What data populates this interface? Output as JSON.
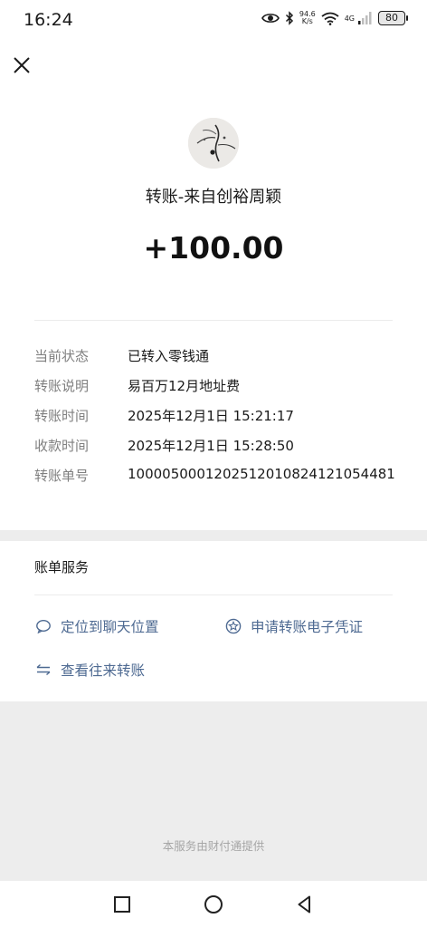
{
  "status_bar": {
    "time": "16:24",
    "net_speed_value": "94.6",
    "net_speed_unit": "K/s",
    "net_type": "4G",
    "battery": "80",
    "icons": [
      "eye-icon",
      "bluetooth-icon",
      "wifi-icon",
      "signal-icon",
      "battery-icon"
    ]
  },
  "header": {
    "close_icon": "close-icon"
  },
  "transfer": {
    "title": "转账-来自创裕周颖",
    "amount": "+100.00"
  },
  "details": [
    {
      "label": "当前状态",
      "value": "已转入零钱通"
    },
    {
      "label": "转账说明",
      "value": "易百万12月地址费"
    },
    {
      "label": "转账时间",
      "value": "2025年12月1日 15:21:17"
    },
    {
      "label": "收款时间",
      "value": "2025年12月1日 15:28:50"
    },
    {
      "label": "转账单号",
      "value": "1000050001202512010824121054481"
    }
  ],
  "services": {
    "title": "账单服务",
    "items": [
      {
        "label": "定位到聊天位置",
        "icon": "chat-bubble-icon"
      },
      {
        "label": "申请转账电子凭证",
        "icon": "star-badge-icon"
      },
      {
        "label": "查看往来转账",
        "icon": "exchange-arrows-icon"
      }
    ]
  },
  "footer": {
    "provider": "本服务由财付通提供"
  },
  "nav_bar": {
    "icons": [
      "square-recents-icon",
      "circle-home-icon",
      "triangle-back-icon"
    ]
  },
  "colors": {
    "link": "#4e6a92",
    "label": "#7f7f7f",
    "background": "#ededed",
    "card": "#ffffff"
  }
}
